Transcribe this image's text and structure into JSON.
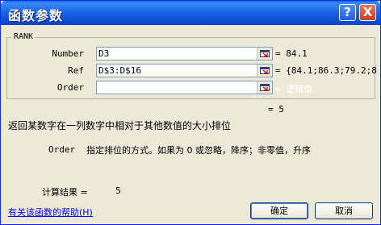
{
  "window": {
    "title": "函数参数"
  },
  "titlebar": {
    "help_icon": "?",
    "close_icon": "X"
  },
  "function_group": {
    "name": "RANK",
    "arguments": [
      {
        "label": "Number",
        "value": "D3",
        "result": "= 84.1"
      },
      {
        "label": "Ref",
        "value": "D$3:D$16",
        "result": "= {84.1;86.3;79.2;8"
      },
      {
        "label": "Order",
        "value": "",
        "result": "= 逻辑值"
      }
    ]
  },
  "function_result": "= 5",
  "description": "返回某数字在一列数字中相对于其他数值的大小排位",
  "argument_help": {
    "name": "Order",
    "text": "指定排位的方式。如果为 0 或忽略，降序；非零值，升序"
  },
  "calc_result": {
    "label": "计算结果 =",
    "value": "5"
  },
  "help_link": "有关该函数的帮助(H)",
  "buttons": {
    "ok": "确定",
    "cancel": "取消"
  },
  "colors": {
    "titlebar": "#0a4fd6",
    "dialog_bg": "#ece9d8",
    "link": "#0000ee"
  }
}
